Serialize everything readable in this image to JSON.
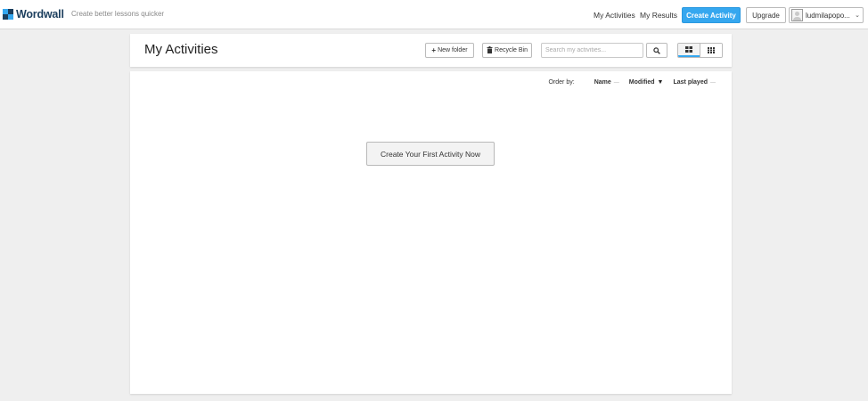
{
  "brand": {
    "name": "Wordwall",
    "tagline": "Create better lessons quicker",
    "colors": {
      "blue": "#35a7ef",
      "dark": "#1c3f5e"
    }
  },
  "nav": {
    "my_activities": "My Activities",
    "my_results": "My Results",
    "create_activity": "Create Activity",
    "upgrade": "Upgrade",
    "user_name": "ludmilapopo..."
  },
  "header": {
    "title": "My Activities",
    "new_folder": "New folder",
    "recycle_bin": "Recycle Bin",
    "search_placeholder": "Search my activities..."
  },
  "order": {
    "label": "Order by:",
    "options": [
      {
        "label": "Name",
        "active": false
      },
      {
        "label": "Modified",
        "active": true
      },
      {
        "label": "Last played",
        "active": false
      }
    ]
  },
  "empty_state": {
    "button": "Create Your First Activity Now"
  },
  "icons": {
    "new_folder": "plus-icon",
    "recycle_bin": "trash-icon",
    "search": "search-icon",
    "view_large": "grid-large-icon",
    "view_small": "grid-small-icon",
    "user_menu": "chevron-down-icon"
  }
}
